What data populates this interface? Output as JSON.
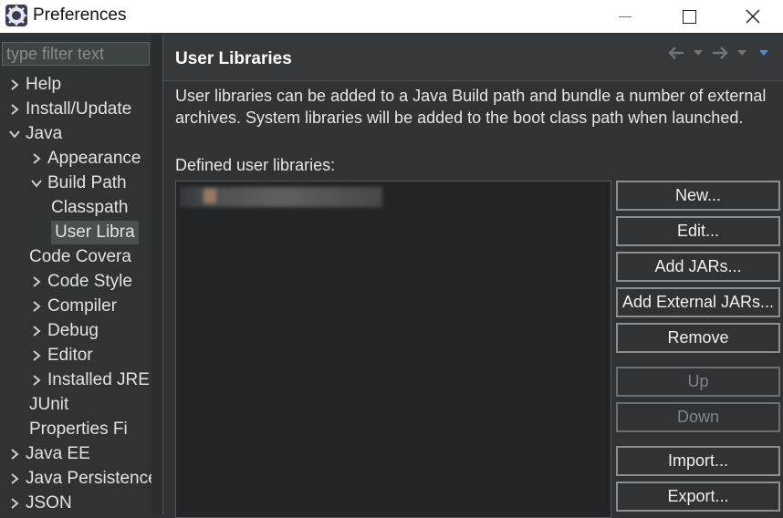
{
  "window": {
    "title": "Preferences"
  },
  "filter": {
    "placeholder": "type filter text"
  },
  "tree": {
    "items": [
      {
        "label": "Help",
        "chevron": "right"
      },
      {
        "label": "Install/Update",
        "chevron": "right"
      },
      {
        "label": "Java",
        "chevron": "down"
      },
      {
        "label": "Appearance",
        "chevron": "right"
      },
      {
        "label": "Build Path",
        "chevron": "down"
      },
      {
        "label": "Classpath",
        "chevron": "none"
      },
      {
        "label": "User Libra",
        "chevron": "none",
        "selected": true
      },
      {
        "label": "Code Covera",
        "chevron": "none"
      },
      {
        "label": "Code Style",
        "chevron": "right"
      },
      {
        "label": "Compiler",
        "chevron": "right"
      },
      {
        "label": "Debug",
        "chevron": "right"
      },
      {
        "label": "Editor",
        "chevron": "right"
      },
      {
        "label": "Installed JRE",
        "chevron": "right"
      },
      {
        "label": "JUnit",
        "chevron": "none"
      },
      {
        "label": "Properties Fi",
        "chevron": "none"
      },
      {
        "label": "Java EE",
        "chevron": "right"
      },
      {
        "label": "Java Persistence",
        "chevron": "right"
      },
      {
        "label": "JSON",
        "chevron": "right"
      }
    ]
  },
  "page": {
    "title": "User Libraries",
    "description": "User libraries can be added to a Java Build path and bundle a number of external archives. System libraries will be added to the boot class path when launched.",
    "defined_label": "Defined user libraries:"
  },
  "buttons": {
    "new": "New...",
    "edit": "Edit...",
    "add_jars": "Add JARs...",
    "add_external_jars": "Add External JARs...",
    "remove": "Remove",
    "up": "Up",
    "down": "Down",
    "import": "Import...",
    "export": "Export..."
  },
  "colors": {
    "background": "#2f3336",
    "nav_arrow": "#6e7478",
    "nav_menu_accent": "#4f8fd6"
  }
}
